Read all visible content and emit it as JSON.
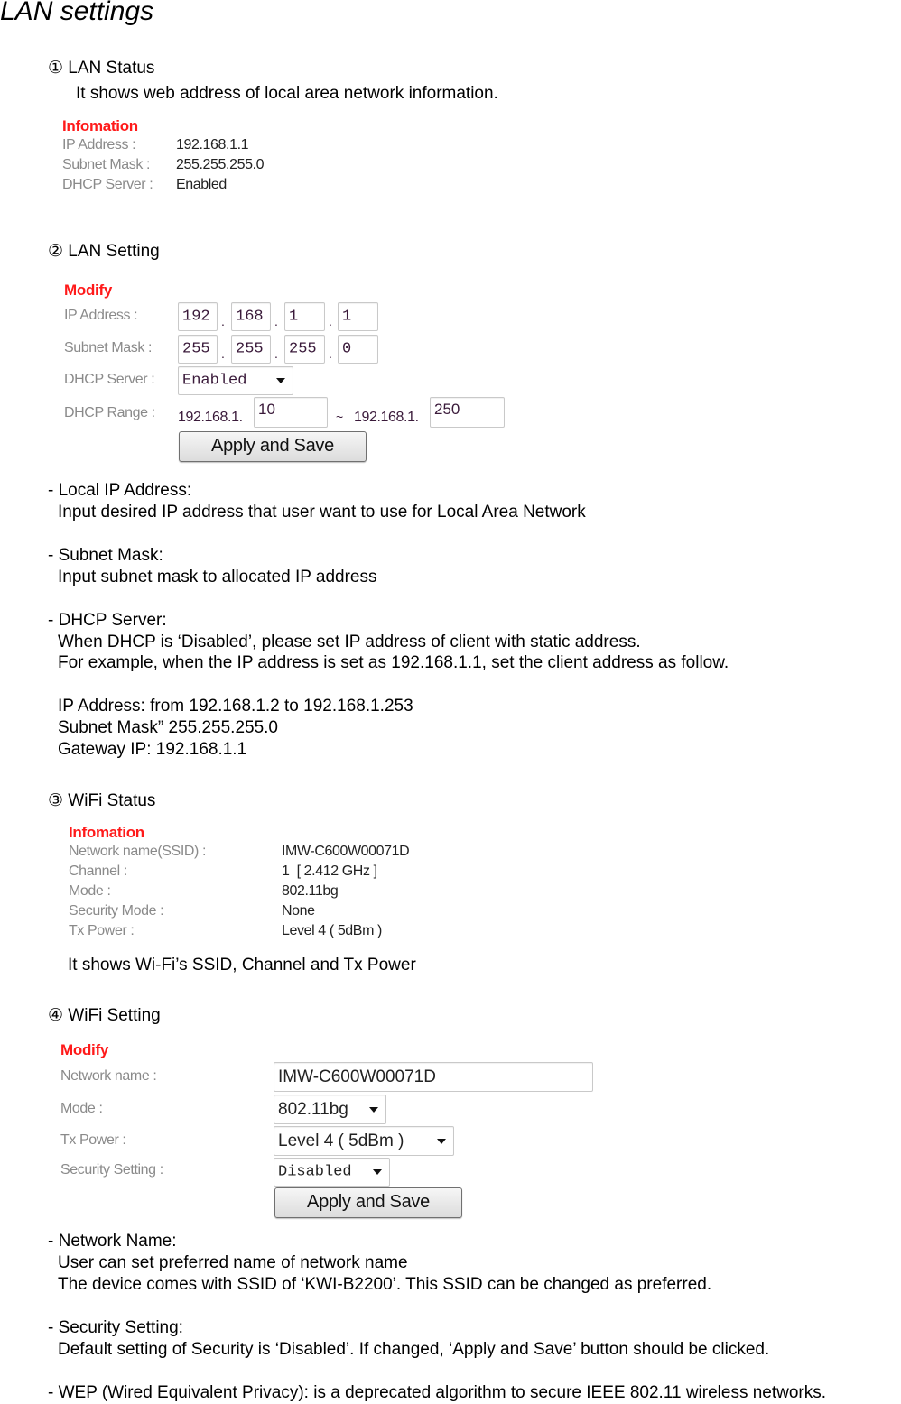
{
  "page": {
    "title": "LAN settings"
  },
  "lan_status": {
    "heading": "① LAN Status",
    "description": "It shows web address of local area network information.",
    "panel": {
      "header": "Infomation",
      "rows": [
        {
          "label": "IP Address :",
          "value": "192.168.1.1"
        },
        {
          "label": "Subnet Mask :",
          "value": "255.255.255.0"
        },
        {
          "label": "DHCP Server :",
          "value": "Enabled"
        }
      ]
    }
  },
  "lan_setting": {
    "heading": "② LAN Setting",
    "panel": {
      "header": "Modify",
      "ip_label": "IP Address :",
      "ip_octets": [
        "192",
        "168",
        "1",
        "1"
      ],
      "mask_label": "Subnet Mask :",
      "mask_octets": [
        "255",
        "255",
        "255",
        "0"
      ],
      "dhcp_label": "DHCP Server :",
      "dhcp_selected": "Enabled",
      "range_label": "DHCP Range :",
      "range_prefix": "192.168.1.",
      "range_start": "10",
      "range_sep": "~",
      "range_end": "250",
      "apply_label": "Apply and Save",
      "dot": "."
    },
    "notes": [
      {
        "title": "- Local IP Address:",
        "lines": [
          "Input desired IP address that user want to use for Local Area Network"
        ]
      },
      {
        "title": "- Subnet Mask:",
        "lines": [
          "Input subnet mask to allocated IP address"
        ]
      },
      {
        "title": "- DHCP Server:",
        "lines": [
          "When DHCP is ‘Disabled’, please set IP address of client with static address.",
          "For example, when the IP address is set as 192.168.1.1, set the client address as follow."
        ]
      }
    ],
    "example": [
      "IP Address: from 192.168.1.2 to 192.168.1.253",
      "Subnet Mask” 255.255.255.0",
      "Gateway IP: 192.168.1.1"
    ]
  },
  "wifi_status": {
    "heading": "③ WiFi Status",
    "panel": {
      "header": "Infomation",
      "rows": [
        {
          "label": "Network name(SSID) :",
          "value": "IMW-C600W00071D"
        },
        {
          "label": "Channel :",
          "value": "1  [ 2.412 GHz ]"
        },
        {
          "label": "Mode :",
          "value": "802.11bg"
        },
        {
          "label": "Security Mode :",
          "value": "None"
        },
        {
          "label": "Tx Power :",
          "value": "Level 4 ( 5dBm )"
        }
      ]
    },
    "description": "It shows Wi-Fi’s SSID, Channel and Tx Power"
  },
  "wifi_setting": {
    "heading": "④ WiFi Setting",
    "panel": {
      "header": "Modify",
      "name_label": "Network name :",
      "name_value": "IMW-C600W00071D",
      "mode_label": "Mode :",
      "mode_selected": "802.11bg",
      "tx_label": "Tx Power :",
      "tx_selected": "Level 4 ( 5dBm )",
      "security_label": "Security Setting :",
      "security_selected": "Disabled",
      "apply_label": "Apply and Save"
    },
    "notes": [
      {
        "title": "- Network Name:",
        "lines": [
          "User can set preferred name of network name",
          "The device comes with SSID of ‘KWI-B2200’. This SSID can be changed as preferred."
        ]
      },
      {
        "title": "- Security Setting:",
        "lines": [
          "Default setting of Security is ‘Disabled’. If changed, ‘Apply and Save’ button should be clicked."
        ]
      },
      {
        "title": "- WEP (Wired Equivalent Privacy): is a deprecated algorithm to secure IEEE 802.11 wireless networks.",
        "lines": []
      }
    ]
  }
}
